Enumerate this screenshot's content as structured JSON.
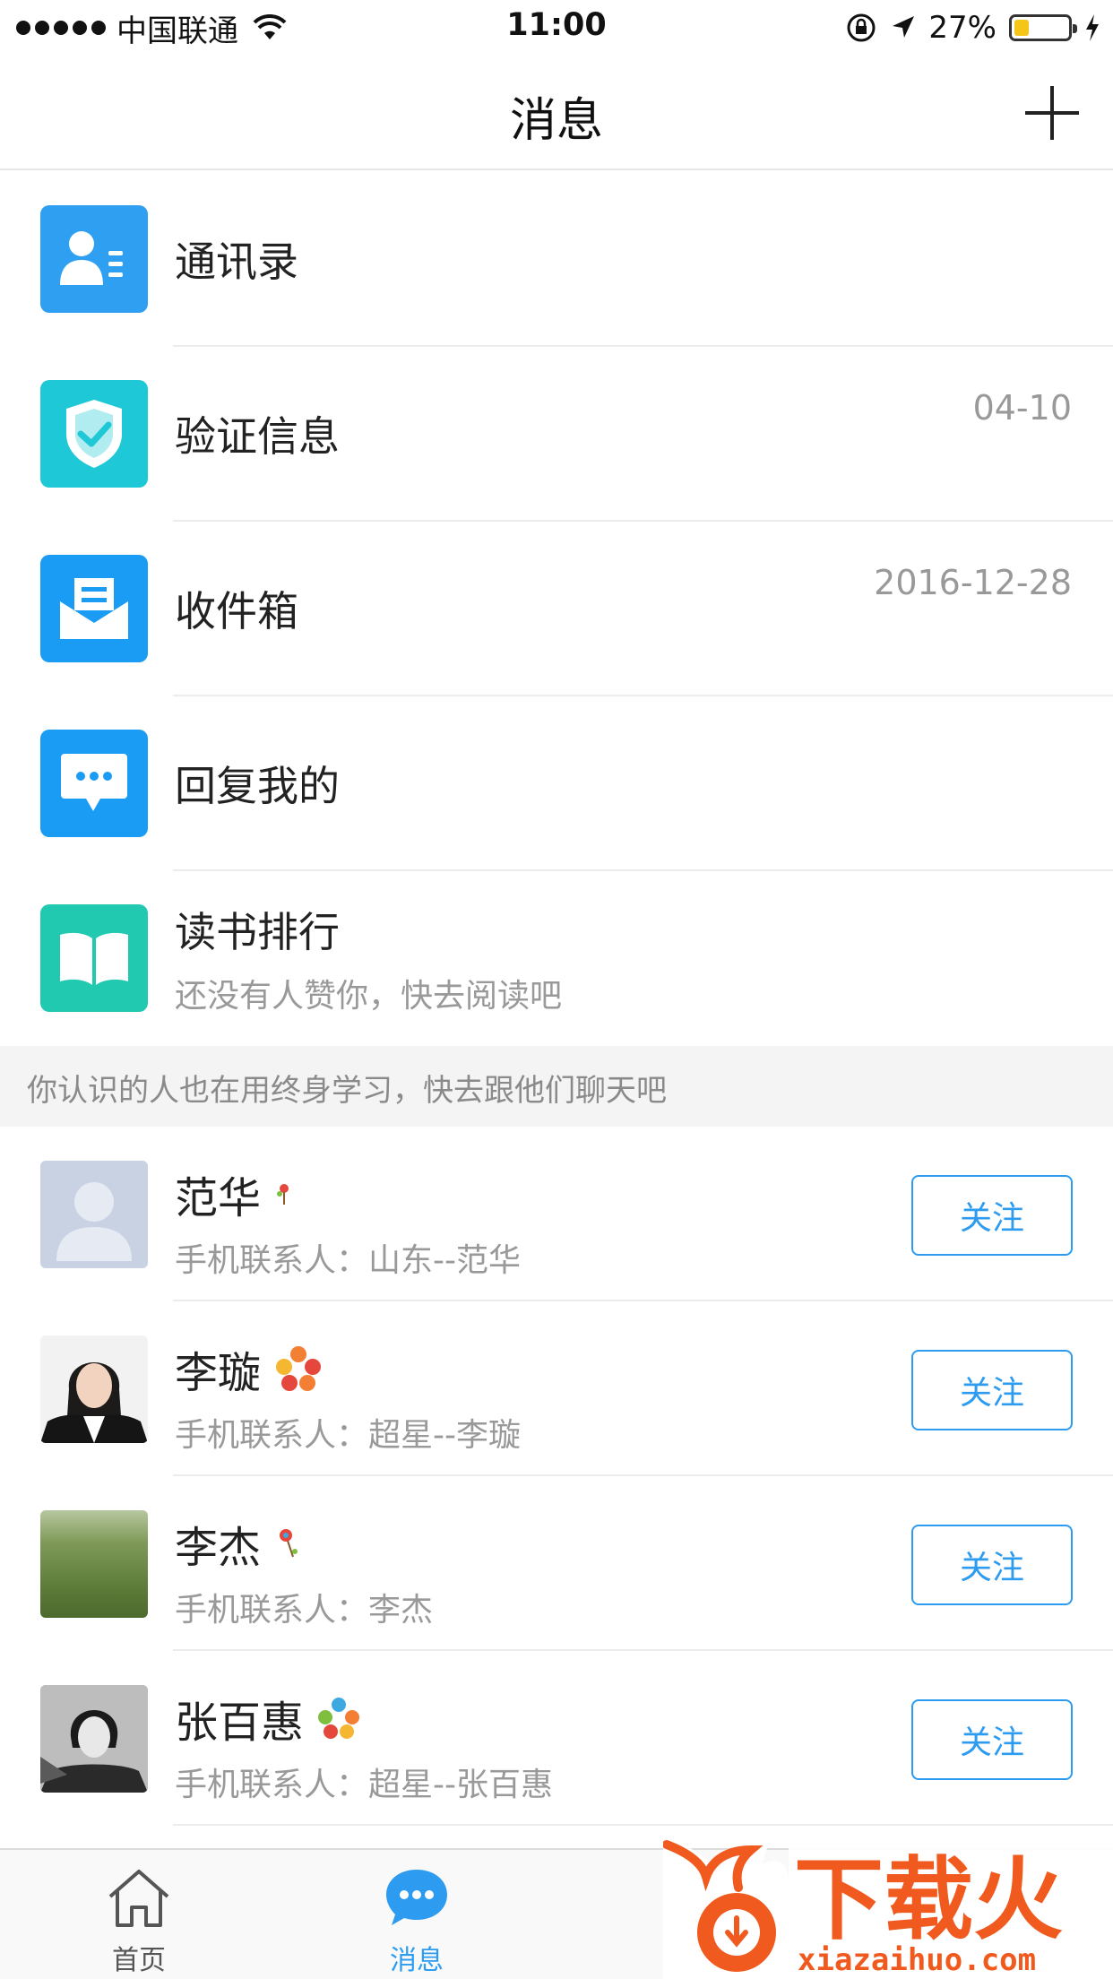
{
  "status_bar": {
    "carrier": "中国联通",
    "time": "11:00",
    "battery": "27%",
    "battery_level": 0.27,
    "battery_color": "#f5c518"
  },
  "nav": {
    "title": "消息",
    "add_icon": "plus-icon"
  },
  "menu": [
    {
      "label": "通讯录",
      "sub": "",
      "date": "",
      "icon": "contacts-icon",
      "color": "#2f9ff2"
    },
    {
      "label": "验证信息",
      "sub": "",
      "date": "04-10",
      "icon": "shield-check-icon",
      "color": "#1fc8d6"
    },
    {
      "label": "收件箱",
      "sub": "",
      "date": "2016-12-28",
      "icon": "inbox-icon",
      "color": "#1a9cf4"
    },
    {
      "label": "回复我的",
      "sub": "",
      "date": "",
      "icon": "chat-bubble-icon",
      "color": "#1a9cf4"
    },
    {
      "label": "读书排行",
      "sub": "还没有人赞你，快去阅读吧",
      "date": "",
      "icon": "book-icon",
      "color": "#20c9b0"
    }
  ],
  "section_header": "你认识的人也在用终身学习，快去跟他们聊天吧",
  "contacts": [
    {
      "name": "范华",
      "sub": "手机联系人：山东--范华",
      "follow": "关注",
      "avatar": "default-avatar"
    },
    {
      "name": "李璇",
      "sub": "手机联系人：超星--李璇",
      "follow": "关注",
      "avatar": "photo-avatar"
    },
    {
      "name": "李杰",
      "sub": "手机联系人：李杰",
      "follow": "关注",
      "avatar": "grass-avatar"
    },
    {
      "name": "张百惠",
      "sub": "手机联系人：超星--张百惠",
      "follow": "关注",
      "avatar": "portrait-avatar"
    }
  ],
  "tabs": [
    {
      "label": "首页",
      "icon": "home-icon",
      "active": false
    },
    {
      "label": "消息",
      "icon": "message-icon",
      "active": true
    }
  ],
  "watermark": {
    "title": "下载火",
    "url": "xiazaihuo.com"
  },
  "colors": {
    "accent": "#2d9cf0",
    "separator": "#ececec",
    "section_bg": "#f4f4f4",
    "watermark": "#f05a1e"
  }
}
